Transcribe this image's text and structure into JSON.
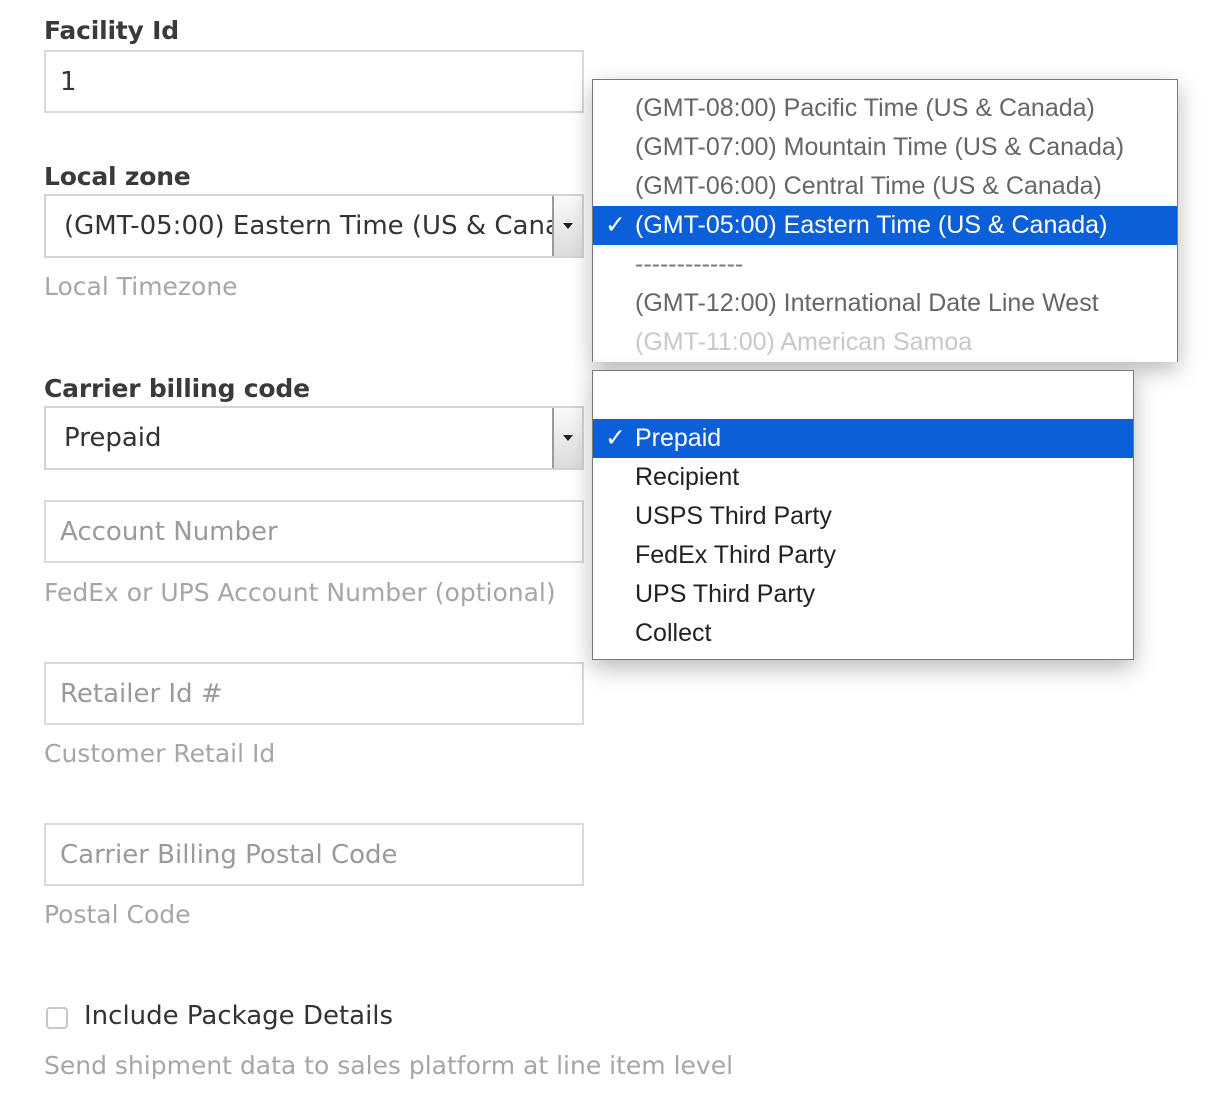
{
  "facility": {
    "label": "Facility Id",
    "value": "1"
  },
  "local_zone": {
    "label": "Local zone",
    "value": "(GMT-05:00) Eastern Time (US & Canada)",
    "help": "Local Timezone",
    "options": [
      "(GMT-08:00) Pacific Time (US & Canada)",
      "(GMT-07:00) Mountain Time (US & Canada)",
      "(GMT-06:00) Central Time (US & Canada)",
      "(GMT-05:00) Eastern Time (US & Canada)",
      "-------------",
      "(GMT-12:00) International Date Line West",
      "(GMT-11:00) American Samoa"
    ]
  },
  "carrier_billing": {
    "label": "Carrier billing code",
    "value": "Prepaid",
    "options": [
      "",
      "Prepaid",
      "Recipient",
      "USPS Third Party",
      "FedEx Third Party",
      "UPS Third Party",
      "Collect"
    ]
  },
  "account_number": {
    "placeholder": "Account Number",
    "help": "FedEx or UPS Account Number (optional)"
  },
  "retailer_id": {
    "placeholder": "Retailer Id #",
    "help": "Customer Retail Id"
  },
  "postal_code": {
    "placeholder": "Carrier Billing Postal Code",
    "help": "Postal Code"
  },
  "package_details": {
    "label": "Include Package Details",
    "checked": false,
    "help": "Send shipment data to sales platform at line item level"
  },
  "check_mark": "✓"
}
